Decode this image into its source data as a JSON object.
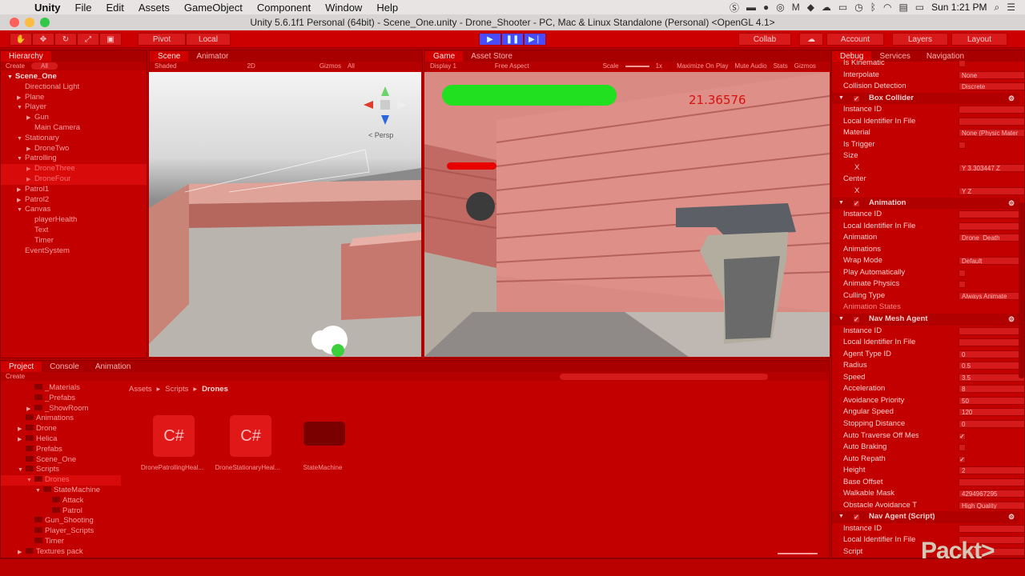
{
  "menubar": {
    "apple": "",
    "items": [
      "Unity",
      "File",
      "Edit",
      "Assets",
      "GameObject",
      "Component",
      "Window",
      "Help"
    ],
    "clock": "Sun 1:21 PM"
  },
  "window_title": "Unity 5.6.1f1 Personal (64bit) - Scene_One.unity - Drone_Shooter - PC, Mac & Linux Standalone (Personal) <OpenGL 4.1>",
  "toolbar": {
    "pivot": "Pivot",
    "local": "Local",
    "collab": "Collab",
    "account": "Account",
    "layers": "Layers",
    "layout": "Layout"
  },
  "hierarchy": {
    "tab": "Hierarchy",
    "create": "Create",
    "search_placeholder": "All",
    "items": [
      {
        "label": "Scene_One",
        "indent": 0,
        "bold": true,
        "arrow": "▼"
      },
      {
        "label": "Directional Light",
        "indent": 1
      },
      {
        "label": "Plane",
        "indent": 1,
        "arrow": "▶"
      },
      {
        "label": "Player",
        "indent": 1,
        "arrow": "▼"
      },
      {
        "label": "Gun",
        "indent": 2,
        "arrow": "▶"
      },
      {
        "label": "Main Camera",
        "indent": 2
      },
      {
        "label": "Stationary",
        "indent": 1,
        "arrow": "▼"
      },
      {
        "label": "DroneTwo",
        "indent": 2,
        "arrow": "▶"
      },
      {
        "label": "Patrolling",
        "indent": 1,
        "arrow": "▼"
      },
      {
        "label": "DroneThree",
        "indent": 2,
        "arrow": "▶",
        "selected": true
      },
      {
        "label": "DroneFour",
        "indent": 2,
        "arrow": "▶",
        "selected": true
      },
      {
        "label": "Patrol1",
        "indent": 1,
        "arrow": "▶"
      },
      {
        "label": "Patrol2",
        "indent": 1,
        "arrow": "▶"
      },
      {
        "label": "Canvas",
        "indent": 1,
        "arrow": "▼"
      },
      {
        "label": "playerHealth",
        "indent": 2
      },
      {
        "label": "Text",
        "indent": 2
      },
      {
        "label": "Timer",
        "indent": 2
      },
      {
        "label": "EventSystem",
        "indent": 1
      }
    ]
  },
  "scene": {
    "tabs": [
      "Scene",
      "Animator"
    ],
    "shading": "Shaded",
    "mode2d": "2D",
    "gizmos": "Gizmos",
    "search": "All",
    "persp": "< Persp"
  },
  "game": {
    "tabs": [
      "Game",
      "Asset Store"
    ],
    "display": "Display 1",
    "aspect": "Free Aspect",
    "scale_label": "Scale",
    "scale_value": "1x",
    "maximize": "Maximize On Play",
    "mute": "Mute Audio",
    "stats": "Stats",
    "gizmos": "Gizmos",
    "timer_text": "21.36576"
  },
  "project": {
    "tabs": [
      "Project",
      "Console",
      "Animation"
    ],
    "create": "Create",
    "breadcrumb": [
      "Assets",
      "Scripts",
      "Drones"
    ],
    "tree": [
      {
        "label": "_Materials",
        "indent": 2
      },
      {
        "label": "_Prefabs",
        "indent": 2
      },
      {
        "label": "_ShowRoom",
        "indent": 2,
        "arrow": "▶"
      },
      {
        "label": "Animations",
        "indent": 1
      },
      {
        "label": "Drone",
        "indent": 1,
        "arrow": "▶"
      },
      {
        "label": "Helica",
        "indent": 1,
        "arrow": "▶"
      },
      {
        "label": "Prefabs",
        "indent": 1
      },
      {
        "label": "Scene_One",
        "indent": 1
      },
      {
        "label": "Scripts",
        "indent": 1,
        "arrow": "▼"
      },
      {
        "label": "Drones",
        "indent": 2,
        "arrow": "▼",
        "selected": true
      },
      {
        "label": "StateMachine",
        "indent": 3,
        "arrow": "▼"
      },
      {
        "label": "Attack",
        "indent": 4
      },
      {
        "label": "Patrol",
        "indent": 4
      },
      {
        "label": "Gun_Shooting",
        "indent": 2
      },
      {
        "label": "Player_Scripts",
        "indent": 2
      },
      {
        "label": "Timer",
        "indent": 2
      },
      {
        "label": "Textures pack",
        "indent": 1,
        "arrow": "▶"
      }
    ],
    "assets": [
      {
        "label": "DronePatrollingHeal...",
        "type": "cs",
        "glyph": "C#"
      },
      {
        "label": "DroneStationaryHeal...",
        "type": "cs",
        "glyph": "C#"
      },
      {
        "label": "StateMachine",
        "type": "folder",
        "glyph": ""
      }
    ]
  },
  "inspector": {
    "tabs": [
      "Debug",
      "Services",
      "Navigation"
    ],
    "rows": [
      {
        "label": "Is Kinematic",
        "kind": "check",
        "value": ""
      },
      {
        "label": "Interpolate",
        "kind": "field",
        "value": "None"
      },
      {
        "label": "Collision Detection",
        "kind": "field",
        "value": "Discrete"
      },
      {
        "label": "Box Collider",
        "kind": "header"
      },
      {
        "label": "Instance ID",
        "kind": "field",
        "value": ""
      },
      {
        "label": "Local Identifier In File",
        "kind": "field",
        "value": ""
      },
      {
        "label": "Material",
        "kind": "field",
        "value": "None (Physic Mater"
      },
      {
        "label": "Is Trigger",
        "kind": "check",
        "value": ""
      },
      {
        "label": "Size",
        "kind": "plain"
      },
      {
        "label": "X",
        "kind": "xyz",
        "value": "Y  3.303447   Z"
      },
      {
        "label": "Center",
        "kind": "plain"
      },
      {
        "label": "X",
        "kind": "xyz",
        "value": "Y              Z"
      },
      {
        "label": "Animation",
        "kind": "header"
      },
      {
        "label": "Instance ID",
        "kind": "field",
        "value": ""
      },
      {
        "label": "Local Identifier In File",
        "kind": "field",
        "value": ""
      },
      {
        "label": "Animation",
        "kind": "field",
        "value": "Drone_Death"
      },
      {
        "label": "Animations",
        "kind": "plain"
      },
      {
        "label": "Wrap Mode",
        "kind": "field",
        "value": "Default"
      },
      {
        "label": "Play Automatically",
        "kind": "check",
        "value": ""
      },
      {
        "label": "Animate Physics",
        "kind": "check",
        "value": ""
      },
      {
        "label": "Culling Type",
        "kind": "field",
        "value": "Always Animate"
      },
      {
        "label": "Animation States",
        "kind": "dim"
      },
      {
        "label": "Nav Mesh Agent",
        "kind": "header"
      },
      {
        "label": "Instance ID",
        "kind": "field",
        "value": ""
      },
      {
        "label": "Local Identifier In File",
        "kind": "field",
        "value": ""
      },
      {
        "label": "Agent Type ID",
        "kind": "field",
        "value": "0"
      },
      {
        "label": "Radius",
        "kind": "field",
        "value": "0.5"
      },
      {
        "label": "Speed",
        "kind": "field",
        "value": "3.5"
      },
      {
        "label": "Acceleration",
        "kind": "field",
        "value": "8"
      },
      {
        "label": "Avoidance Priority",
        "kind": "field",
        "value": "50"
      },
      {
        "label": "Angular Speed",
        "kind": "field",
        "value": "120"
      },
      {
        "label": "Stopping Distance",
        "kind": "field",
        "value": "0"
      },
      {
        "label": "Auto Traverse Off Mes",
        "kind": "check",
        "value": "✓"
      },
      {
        "label": "Auto Braking",
        "kind": "check",
        "value": ""
      },
      {
        "label": "Auto Repath",
        "kind": "check",
        "value": "✓"
      },
      {
        "label": "Height",
        "kind": "field",
        "value": "2"
      },
      {
        "label": "Base Offset",
        "kind": "field",
        "value": ""
      },
      {
        "label": "Walkable Mask",
        "kind": "field",
        "value": "4294967295"
      },
      {
        "label": "Obstacle Avoidance T",
        "kind": "field",
        "value": "High Quality"
      },
      {
        "label": "Nav Agent (Script)",
        "kind": "header"
      },
      {
        "label": "Instance ID",
        "kind": "field",
        "value": ""
      },
      {
        "label": "Local Identifier In File",
        "kind": "field",
        "value": ""
      },
      {
        "label": "Script",
        "kind": "field",
        "value": ""
      }
    ]
  },
  "watermark": "Packt>"
}
